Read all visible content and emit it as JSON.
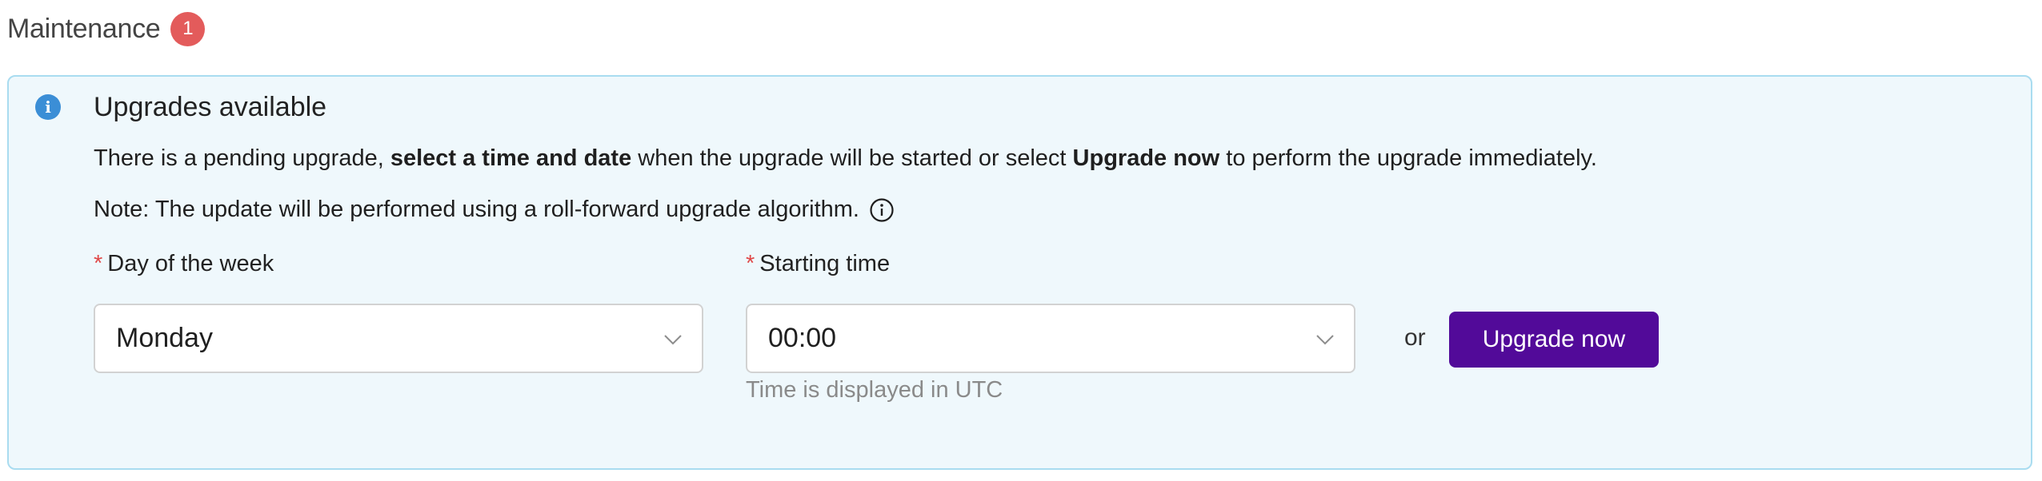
{
  "section": {
    "title": "Maintenance",
    "badge_count": "1"
  },
  "alert": {
    "icon": "info-icon",
    "title": "Upgrades available",
    "text_part1": "There is a pending upgrade, ",
    "text_bold1": "select a time and date",
    "text_part2": " when the upgrade will be started or select ",
    "text_bold2": "Upgrade now",
    "text_part3": " to perform the upgrade immediately.",
    "note": "Note: The update will be performed using a roll-forward upgrade algorithm.",
    "note_icon": "info-circle-icon"
  },
  "form": {
    "day_label": "Day of the week",
    "day_value": "Monday",
    "time_label": "Starting time",
    "time_value": "00:00",
    "time_helper": "Time is displayed in UTC",
    "required_marker": "*",
    "or_text": "or",
    "upgrade_button_label": "Upgrade now"
  },
  "colors": {
    "badge": "#e35b5b",
    "alert_background": "#eff8fc",
    "alert_border": "#a9dcf0",
    "info_icon": "#3b8ed6",
    "required": "#e04848",
    "primary_button": "#520a99"
  }
}
